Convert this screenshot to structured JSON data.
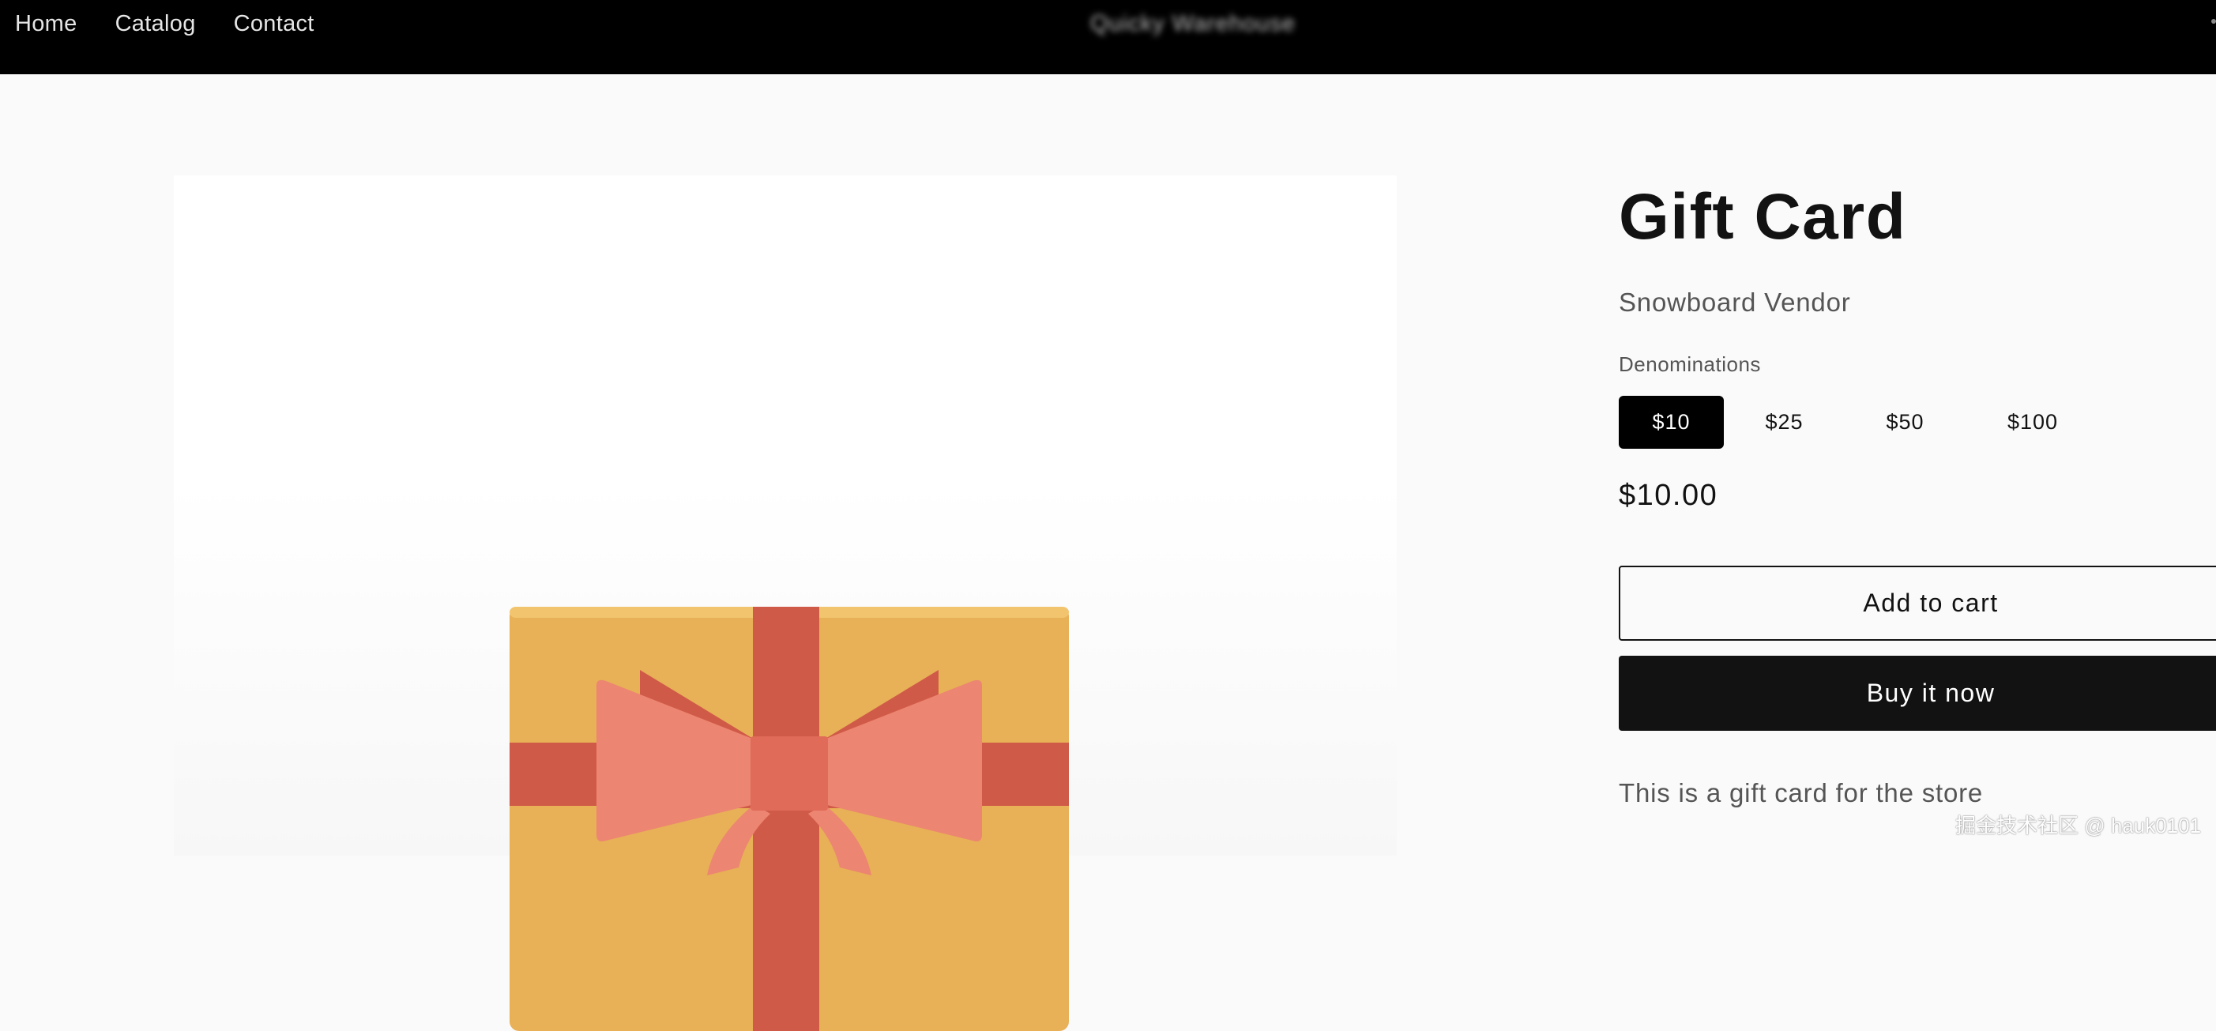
{
  "header": {
    "nav": [
      "Home",
      "Catalog",
      "Contact"
    ],
    "store_name": "Quicky Warehouse"
  },
  "product": {
    "title": "Gift Card",
    "vendor": "Snowboard Vendor",
    "option_label": "Denominations",
    "options": [
      "$10",
      "$25",
      "$50",
      "$100"
    ],
    "selected_option": "$10",
    "price": "$10.00",
    "add_to_cart": "Add to cart",
    "buy_now": "Buy it now",
    "description": "This is a gift card for the store"
  },
  "media": {
    "icon": "gift-box-icon",
    "colors": {
      "box": "#E8B057",
      "ribbon": "#D05A48",
      "bow": "#EC8571",
      "knot": "#E06B58"
    }
  },
  "watermark": "掘金技术社区 @ hauk0101"
}
